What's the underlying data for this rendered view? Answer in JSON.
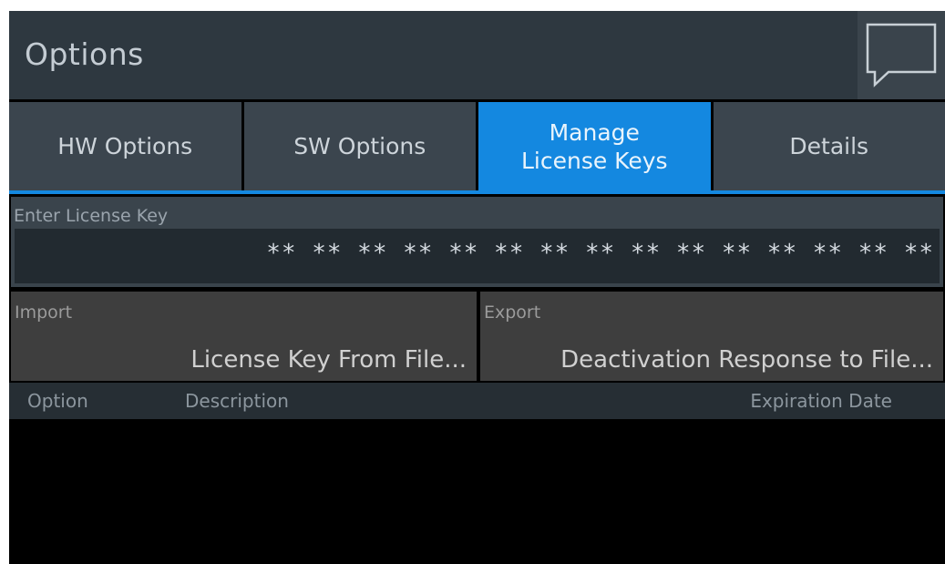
{
  "header": {
    "title": "Options"
  },
  "tabs": [
    {
      "label": "HW Options",
      "active": false
    },
    {
      "label": "SW Options",
      "active": false
    },
    {
      "label": "Manage\nLicense Keys",
      "active": true
    },
    {
      "label": "Details",
      "active": false
    }
  ],
  "license_key": {
    "label": "Enter License Key",
    "value": "** ** ** ** ** ** ** ** ** ** ** ** ** ** **"
  },
  "import": {
    "label": "Import",
    "value": "License Key From File..."
  },
  "export": {
    "label": "Export",
    "value": "Deactivation Response to File..."
  },
  "table": {
    "columns": [
      "Option",
      "Description",
      "Expiration Date"
    ],
    "rows": []
  },
  "colors": {
    "accent": "#1488e0",
    "background": "#000000",
    "panel": "#3b454e"
  },
  "icons": {
    "message": "speech-bubble-icon"
  }
}
